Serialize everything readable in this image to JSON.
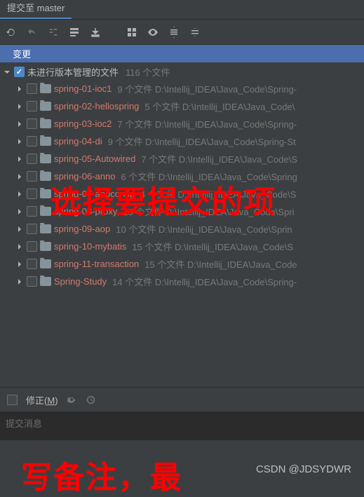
{
  "tab_title": "提交至 master",
  "section_header": "变更",
  "root": {
    "label": "未进行版本管理的文件",
    "meta": "116 个文件"
  },
  "items": [
    {
      "name": "spring-01-ioc1",
      "meta": "9 个文件  D:\\Intellij_IDEA\\Java_Code\\Spring-"
    },
    {
      "name": "spring-02-hellospring",
      "meta": "5 个文件  D:\\Intellij_IDEA\\Java_Code\\"
    },
    {
      "name": "spring-03-ioc2",
      "meta": "7 个文件  D:\\Intellij_IDEA\\Java_Code\\Spring-"
    },
    {
      "name": "spring-04-di",
      "meta": "9 个文件  D:\\Intellij_IDEA\\Java_Code\\Spring-St"
    },
    {
      "name": "spring-05-Autowired",
      "meta": "7 个文件  D:\\Intellij_IDEA\\Java_Code\\S"
    },
    {
      "name": "spring-06-anno",
      "meta": "6 个文件  D:\\Intellij_IDEA\\Java_Code\\Spring"
    },
    {
      "name": "spring-07-appconfig",
      "meta": "4 个文件  D:\\Intellij_IDEA\\Java_Code\\S"
    },
    {
      "name": "spring-08-proxy",
      "meta": "15 个文件  D:\\Intellij_IDEA\\Java_Code\\Spri"
    },
    {
      "name": "spring-09-aop",
      "meta": "10 个文件  D:\\Intellij_IDEA\\Java_Code\\Sprin"
    },
    {
      "name": "spring-10-mybatis",
      "meta": "15 个文件  D:\\Intellij_IDEA\\Java_Code\\S"
    },
    {
      "name": "spring-11-transaction",
      "meta": "15 个文件  D:\\Intellij_IDEA\\Java_Code"
    },
    {
      "name": "Spring-Study",
      "meta": "14 个文件  D:\\Intellij_IDEA\\Java_Code\\Spring-"
    }
  ],
  "amend_label": "修正(M)",
  "commit_placeholder": "提交消息",
  "overlay1": "选择要提交的项",
  "overlay2": "写备注，最",
  "watermark": "CSDN @JDSYDWR"
}
